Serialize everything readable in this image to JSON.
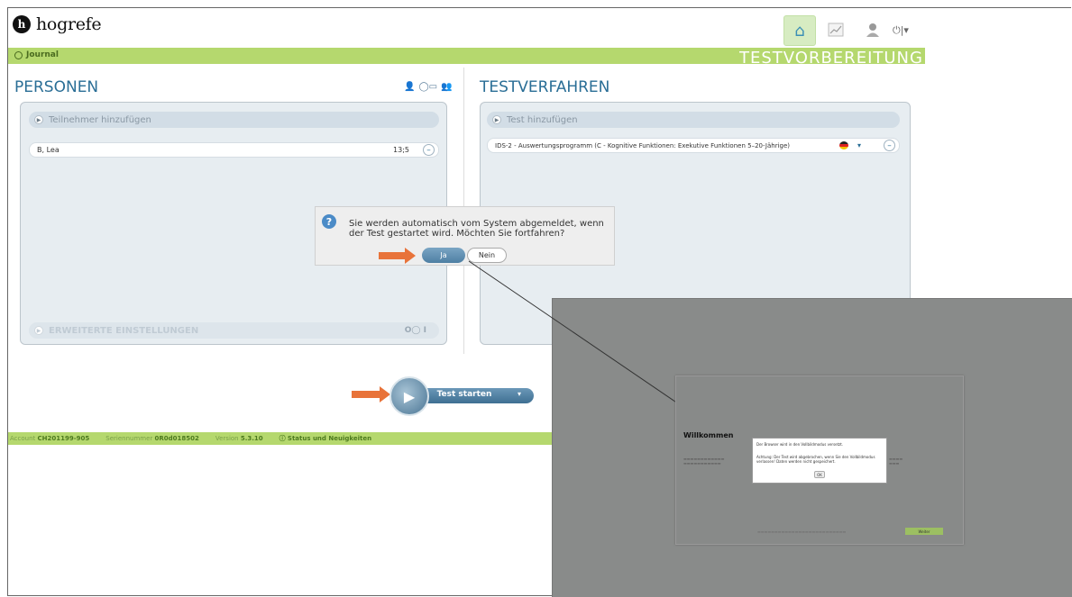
{
  "header": {
    "logo_text": "hogrefe",
    "nav": [
      {
        "icon": "home-icon",
        "active": true
      },
      {
        "icon": "chart-icon",
        "active": false
      },
      {
        "icon": "user-icon",
        "active": false
      }
    ],
    "power_label": "⏻|▾"
  },
  "toolbar": {
    "journal_label": "Journal",
    "mode_label": "TESTVORBEREITUNG"
  },
  "persons": {
    "title": "PERSONEN",
    "add_label": "Teilnehmer hinzufügen",
    "entries": [
      {
        "name": "B, Lea",
        "age": "13;5"
      }
    ],
    "advanced_label": "ERWEITERTE EINSTELLUNGEN"
  },
  "tests": {
    "title": "TESTVERFAHREN",
    "add_label": "Test hinzufügen",
    "entries": [
      {
        "name": "IDS-2 - Auswertungsprogramm (C - Kognitive Funktionen: Exekutive Funktionen 5–20-Jährige)"
      }
    ]
  },
  "start": {
    "label": "Test starten"
  },
  "footer": {
    "account_label": "Account",
    "account_value": "CH201199-905",
    "serial_label": "Seriennummer",
    "serial_value": "0R0d018502",
    "version_label": "Version",
    "version_value": "5.3.10",
    "news_label": "Status und Neuigkeiten"
  },
  "dialog": {
    "message": "Sie werden automatisch vom System abgemeldet, wenn der Test gestartet wird. Möchten Sie fortfahren?",
    "yes_label": "Ja",
    "no_label": "Nein"
  },
  "inset": {
    "title": "Willkommen",
    "popup_line1": "Der Browser wird in den Vollbildmodus versetzt.",
    "popup_line2": "Achtung: Der Test wird abgebrochen, wenn Sie den Vollbildmodus verlassen! Daten werden nicht gespeichert.",
    "ok_label": "OK",
    "next_label": "Weiter"
  },
  "colors": {
    "green_bar": "#b5d86e",
    "title_blue": "#2a6e96",
    "arrow_orange": "#e8733a",
    "overlay_gray": "#898b8a"
  }
}
